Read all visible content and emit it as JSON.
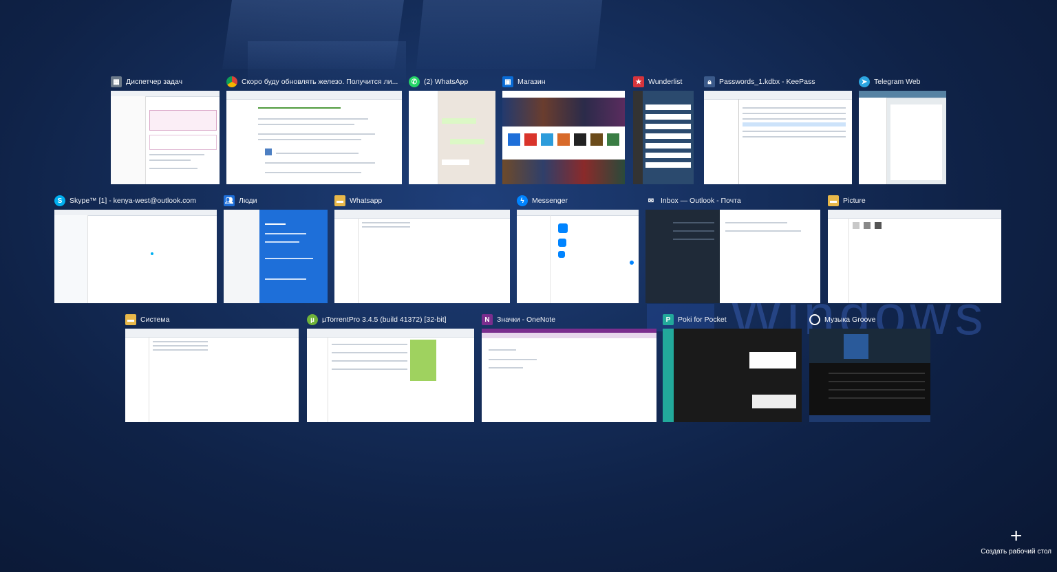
{
  "windows": [
    {
      "title": "Диспетчер задач",
      "icon": "task-manager-icon"
    },
    {
      "title": "Скоро буду обновлять железо. Получится ли...",
      "icon": "chrome-icon"
    },
    {
      "title": "(2) WhatsApp",
      "icon": "whatsapp-icon"
    },
    {
      "title": "Магазин",
      "icon": "store-icon"
    },
    {
      "title": "Wunderlist",
      "icon": "wunderlist-icon"
    },
    {
      "title": "Passwords_1.kdbx - KeePass",
      "icon": "keepass-icon"
    },
    {
      "title": "Telegram Web",
      "icon": "telegram-icon"
    },
    {
      "title": "Skype™ [1] - kenya-west@outlook.com",
      "icon": "skype-icon"
    },
    {
      "title": "Люди",
      "icon": "people-icon"
    },
    {
      "title": "Whatsapp",
      "icon": "folder-icon"
    },
    {
      "title": "Messenger",
      "icon": "messenger-icon"
    },
    {
      "title": "Inbox — Outlook - Почта",
      "icon": "mail-icon"
    },
    {
      "title": "Picture",
      "icon": "folder-icon"
    },
    {
      "title": "Система",
      "icon": "folder-icon"
    },
    {
      "title": "µTorrentPro 3.4.5  (build 41372) [32-bit]",
      "icon": "utorrent-icon"
    },
    {
      "title": "Значки - OneNote",
      "icon": "onenote-icon"
    },
    {
      "title": "Poki for Pocket",
      "icon": "poki-icon"
    },
    {
      "title": "Музыка Groove",
      "icon": "groove-icon"
    }
  ],
  "new_desktop": {
    "plus": "+",
    "label": "Создать рабочий стол"
  },
  "colors": {
    "accent": "#1e6fd9",
    "background": "#10244b"
  }
}
